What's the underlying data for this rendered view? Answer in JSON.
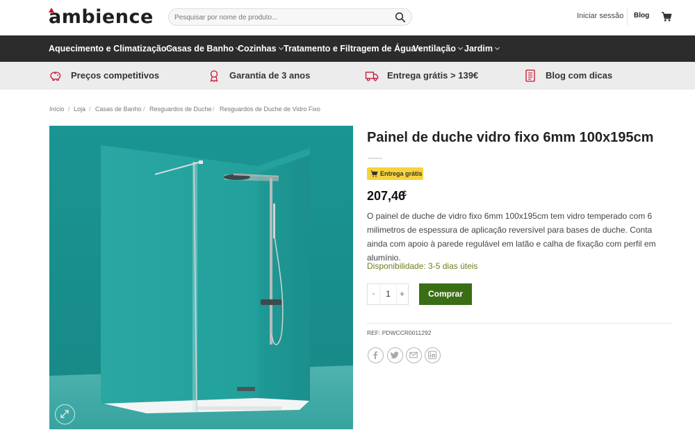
{
  "header": {
    "logo": "ambience",
    "search_placeholder": "Pesquisar por nome de produto...",
    "login": "Iniciar sessão",
    "blog": "Blog"
  },
  "nav": {
    "items": [
      {
        "label": "Aquecimento e Climatização"
      },
      {
        "label": "Casas de Banho"
      },
      {
        "label": "Cozinhas"
      },
      {
        "label": "Tratamento e Filtragem de Água"
      },
      {
        "label": "Ventilação"
      },
      {
        "label": "Jardim"
      }
    ]
  },
  "usp": {
    "items": [
      {
        "label": "Preços competitivos",
        "icon": "piggy-bank-icon"
      },
      {
        "label": "Garantia de 3 anos",
        "icon": "award-ribbon-icon"
      },
      {
        "label": "Entrega grátis > 139€",
        "icon": "delivery-truck-icon"
      },
      {
        "label": "Blog com dicas",
        "icon": "document-icon"
      }
    ]
  },
  "breadcrumb": {
    "items": [
      "Início",
      "Loja",
      "Casas de Banho",
      "Resguardos de Duche",
      "Resguardos de Duche de Vidro Fixo"
    ],
    "separator": "/"
  },
  "product": {
    "title": "Painel de duche vidro fixo 6mm 100x195cm",
    "badge": "Entrega grátis",
    "price": "207,46",
    "currency": "€",
    "description": "O painel de duche de vidro fixo 6mm 100x195cm tem vidro temperado com 6 milimetros de espessura de aplicação reversível para bases de duche. Conta ainda com apoio à parede regulável em latão e calha de fixação com perfil em alumínio.",
    "availability": "Disponibilidade: 3-5 dias úteis",
    "qty_minus": "-",
    "qty_value": "1",
    "qty_plus": "+",
    "buy_label": "Comprar",
    "ref": "REF: PDWCCR0011292",
    "share_icons": [
      "facebook-icon",
      "twitter-icon",
      "email-icon",
      "linkedin-icon"
    ]
  },
  "colors": {
    "nav_bg": "#2c2c2c",
    "usp_bg": "#ececec",
    "buy_button": "#3a6e14",
    "badge": "#f5d33b",
    "availability": "#6b7f1c",
    "image_teal": "#1c9a98"
  }
}
